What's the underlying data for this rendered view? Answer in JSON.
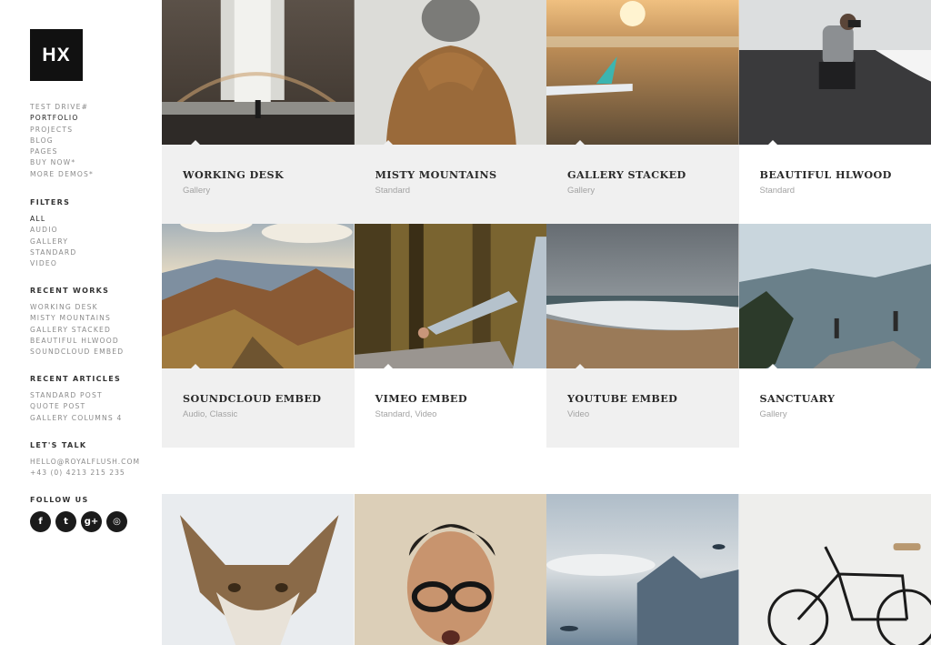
{
  "logo": "HX",
  "nav": [
    "TEST DRIVE#",
    "PORTFOLIO",
    "PROJECTS",
    "BLOG",
    "PAGES",
    "BUY NOW*",
    "MORE DEMOS*"
  ],
  "nav_active": "PORTFOLIO",
  "filters": {
    "title": "FILTERS",
    "items": [
      "ALL",
      "AUDIO",
      "GALLERY",
      "STANDARD",
      "VIDEO"
    ],
    "active": "ALL"
  },
  "recent_works": {
    "title": "RECENT WORKS",
    "items": [
      "WORKING DESK",
      "MISTY MOUNTAINS",
      "GALLERY STACKED",
      "BEAUTIFUL HLWOOD",
      "SOUNDCLOUD EMBED"
    ]
  },
  "recent_articles": {
    "title": "RECENT ARTICLES",
    "items": [
      "STANDARD POST",
      "QUOTE POST",
      "GALLERY COLUMNS 4"
    ]
  },
  "contact": {
    "title": "LET'S TALK",
    "email": "HELLO@ROYALFLUSH.COM",
    "phone": "+43 (0) 4213 215 235"
  },
  "follow": {
    "title": "FOLLOW US",
    "icons": [
      {
        "name": "facebook-icon",
        "glyph": "f"
      },
      {
        "name": "twitter-icon",
        "glyph": "t"
      },
      {
        "name": "google-plus-icon",
        "glyph": "g+"
      },
      {
        "name": "instagram-icon",
        "glyph": "◎"
      }
    ]
  },
  "portfolio": [
    {
      "title": "WORKING DESK",
      "tags": "Gallery",
      "image": "waterfall-rainbow-photo"
    },
    {
      "title": "MISTY MOUNTAINS",
      "tags": "Standard",
      "image": "hooded-hiker-photo"
    },
    {
      "title": "GALLERY STACKED",
      "tags": "Gallery",
      "image": "surfboard-beach-photo"
    },
    {
      "title": "BEAUTIFUL HLWOOD",
      "tags": "Standard",
      "image": "photographer-beach-photo"
    },
    {
      "title": "SOUNDCLOUD EMBED",
      "tags": "Audio, Classic",
      "image": "mountain-valley-photo"
    },
    {
      "title": "VIMEO EMBED",
      "tags": "Standard, Video",
      "image": "hitchhiker-road-photo"
    },
    {
      "title": "YOUTUBE EMBED",
      "tags": "Video",
      "image": "stormy-sea-photo"
    },
    {
      "title": "SANCTUARY",
      "tags": "Gallery",
      "image": "cliff-hikers-photo"
    },
    {
      "title": "",
      "tags": "",
      "image": "coyote-photo"
    },
    {
      "title": "",
      "tags": "",
      "image": "man-glasses-photo"
    },
    {
      "title": "",
      "tags": "",
      "image": "parachutes-sky-photo"
    },
    {
      "title": "",
      "tags": "",
      "image": "bicycle-wall-photo"
    }
  ]
}
